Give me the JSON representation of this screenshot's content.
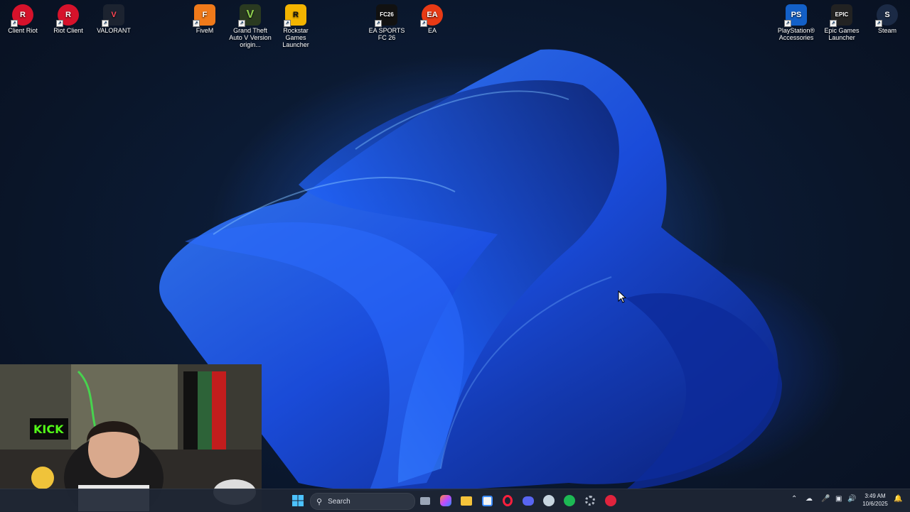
{
  "desktop": {
    "icons": [
      {
        "label": "Client Riot",
        "name": "riot-client-icon",
        "color": "#d6122b",
        "glyph": "R"
      },
      {
        "label": "Riot Client",
        "name": "riot-client-icon",
        "color": "#d6122b",
        "glyph": "R"
      },
      {
        "label": "VALORANT",
        "name": "valorant-icon",
        "color": "#1c2330",
        "glyph": "V"
      },
      {
        "label": "FiveM",
        "name": "fivem-icon",
        "color": "#f07a1a",
        "glyph": "F"
      },
      {
        "label": "Grand Theft Auto V Version origin...",
        "name": "gta-v-icon",
        "color": "#2a3a20",
        "glyph": "V"
      },
      {
        "label": "Rockstar Games Launcher",
        "name": "rockstar-icon",
        "color": "#f3b400",
        "glyph": "R"
      },
      {
        "label": "EA SPORTS FC 26",
        "name": "fc26-icon",
        "color": "#111111",
        "glyph": "FC26"
      },
      {
        "label": "EA",
        "name": "ea-icon",
        "color": "#e83a15",
        "glyph": "EA"
      },
      {
        "label": "PlayStation® Accessories",
        "name": "playstation-accessories-icon",
        "color": "#1360c8",
        "glyph": "PS"
      },
      {
        "label": "Epic Games Launcher",
        "name": "epic-games-icon",
        "color": "#222222",
        "glyph": "EPIC"
      },
      {
        "label": "Steam",
        "name": "steam-icon",
        "color": "#1b2a45",
        "glyph": "S"
      }
    ]
  },
  "webcam": {
    "sign_text": "KICK"
  },
  "taskbar": {
    "search_placeholder": "Search",
    "apps": [
      {
        "name": "start-icon"
      },
      {
        "name": "task-view-icon"
      },
      {
        "name": "copilot-icon"
      },
      {
        "name": "file-explorer-icon"
      },
      {
        "name": "microsoft-store-icon"
      },
      {
        "name": "opera-gx-icon"
      },
      {
        "name": "discord-icon"
      },
      {
        "name": "steam-icon"
      },
      {
        "name": "spotify-icon"
      },
      {
        "name": "settings-icon"
      },
      {
        "name": "app-icon"
      }
    ],
    "clock": {
      "time": "3:49 AM",
      "date": "10/6/2025"
    }
  },
  "colors": {
    "accent": "#2b6cff",
    "taskbar_bg": "#1e2634"
  }
}
